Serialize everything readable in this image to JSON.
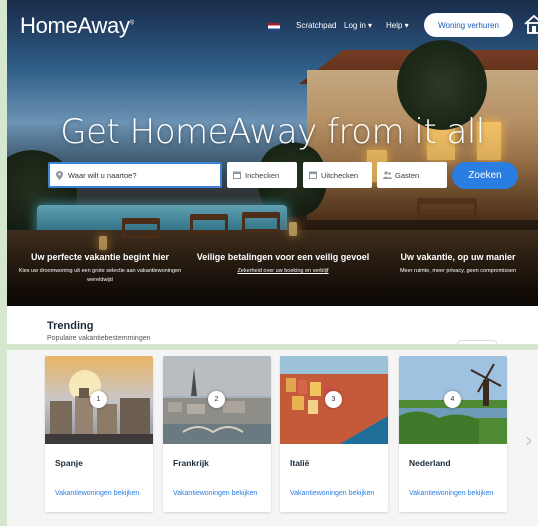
{
  "header": {
    "logo": "HomeAway",
    "logo_mark": "®",
    "nav": {
      "scratchpad": "Scratchpad",
      "login": "Log in ▾",
      "help": "Help ▾"
    },
    "rent_button": "Woning verhuren"
  },
  "hero": {
    "headline": "Get HomeAway from it all"
  },
  "search": {
    "where_placeholder": "Waar wilt u naartoe?",
    "checkin_label": "Inchecken",
    "checkout_label": "Uitchecken",
    "guests_label": "Gasten",
    "search_button": "Zoeken"
  },
  "features": [
    {
      "title": "Uw perfecte vakantie begint hier",
      "text": "Kies uw droomwoning uit een grote selectie aan vakantiewoningen wereldwijd"
    },
    {
      "title": "Veilige betalingen voor een veilig gevoel",
      "link": "Zekerheid over uw boeking en verblijf"
    },
    {
      "title": "Uw vakantie, op uw manier",
      "text": "Meer ruimte, meer privacy, geen compromissen"
    }
  ],
  "trending": {
    "title": "Trending",
    "subtitle": "Populaire vakantiebestemmingen"
  },
  "destinations": [
    {
      "rank": "1",
      "name": "Spanje",
      "link": "Vakantiewoningen bekijken"
    },
    {
      "rank": "2",
      "name": "Frankrijk",
      "link": "Vakantiewoningen bekijken"
    },
    {
      "rank": "3",
      "name": "Italië",
      "link": "Vakantiewoningen bekijken"
    },
    {
      "rank": "4",
      "name": "Nederland",
      "link": "Vakantiewoningen bekijken"
    }
  ],
  "colors": {
    "accent": "#2a7de1",
    "link": "#2a7de1",
    "page_bg": "#d5e8cf"
  },
  "icons": {
    "location": "pin-icon",
    "calendar": "calendar-icon",
    "guests": "people-icon",
    "home": "house-icon",
    "next": "chevron-right-icon"
  }
}
